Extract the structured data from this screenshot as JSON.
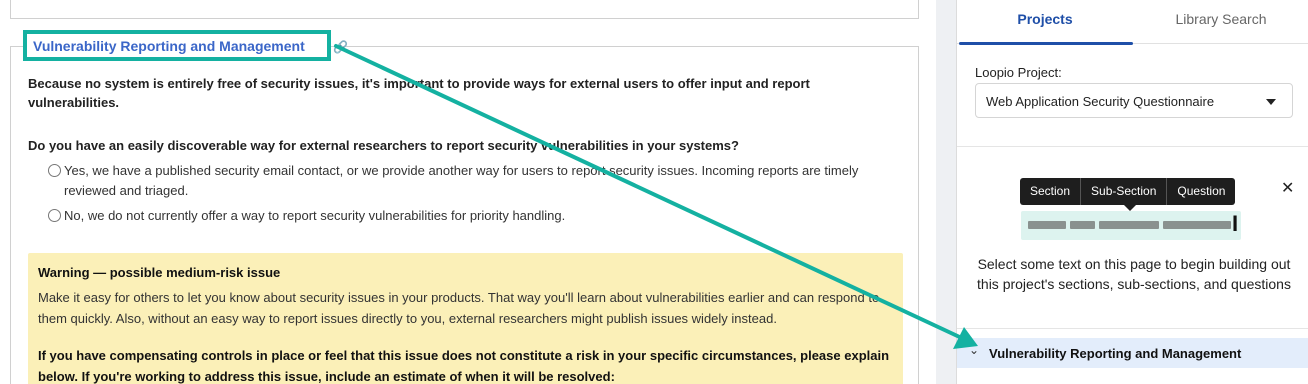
{
  "document": {
    "section_title": "Vulnerability Reporting and Management",
    "intro": "Because no system is entirely free of security issues, it's important to provide ways for external users to offer input and report vulnerabilities.",
    "question": "Do you have an easily discoverable way for external researchers to report security vulnerabilities in your systems?",
    "options": [
      {
        "label": "Yes, we have a published security email contact, or we provide another way for users to report security issues. Incoming reports are timely reviewed and triaged.",
        "selected": false
      },
      {
        "label": "No, we do not currently offer a way to report security vulnerabilities for priority handling.",
        "selected": false
      }
    ],
    "warning": {
      "title": "Warning — possible medium-risk issue",
      "body": "Make it easy for others to let you know about security issues in your products. That way you'll learn about vulnerabilities earlier and can respond to them quickly. Also, without an easy way to report issues directly to you, external researchers might publish issues widely instead.",
      "bold": "If you have compensating controls in place or feel that this issue does not constitute a risk in your specific circumstances, please explain below. If you're working to address this issue, include an estimate of when it will be resolved:"
    }
  },
  "panel": {
    "tabs": [
      {
        "label": "Projects",
        "active": true
      },
      {
        "label": "Library Search",
        "active": false
      }
    ],
    "project_label": "Loopio Project:",
    "project_value": "Web Application Security Questionnaire",
    "tooltip_buttons": [
      "Section",
      "Sub-Section",
      "Question"
    ],
    "hint": "Select some text on this page to begin building out this project's sections, sub-sections, and questions",
    "section_item": "Vulnerability Reporting and Management"
  },
  "colors": {
    "highlight": "#14b1a1",
    "link": "#3a66c8",
    "tab_active": "#1f4fa8",
    "warning_bg": "#fbf0b8",
    "section_row_bg": "#e3edfb"
  },
  "icons": [
    "link-icon",
    "chevron-down-icon",
    "close-icon",
    "text-cursor-icon",
    "dropdown-caret-icon"
  ]
}
